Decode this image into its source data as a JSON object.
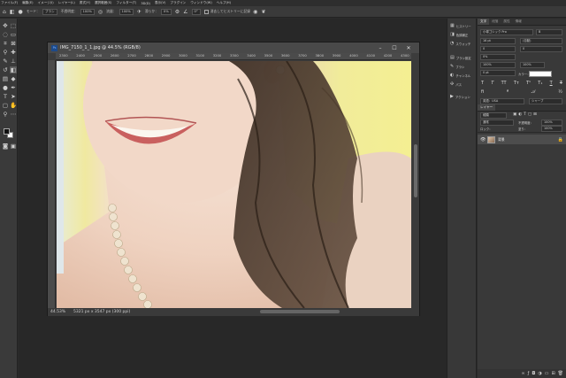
{
  "menubar": {
    "items": [
      "ファイル(F)",
      "編集(E)",
      "イメージ(I)",
      "レイヤー(L)",
      "書式(Y)",
      "選択範囲(S)",
      "フィルター(T)",
      "3D(D)",
      "表示(V)",
      "プラグイン",
      "ウィンドウ(W)",
      "ヘルプ(H)"
    ]
  },
  "options": {
    "mode_label": "モード：",
    "mode_value": "ブラシ",
    "opacity_label": "不透明度：",
    "opacity_value": "100%",
    "flow_label": "流量：",
    "flow_value": "100%",
    "smoothing_label": "滑らか：",
    "smoothing_value": "0%",
    "angle_value": "0°",
    "history_label": "消去してヒストリーに記録"
  },
  "document": {
    "badge": "Ps",
    "title": "IMG_7150_1_1.jpg @ 44.5% (RGB/8)",
    "ruler_ticks": [
      "2300",
      "2400",
      "2500",
      "2600",
      "2700",
      "2800",
      "2900",
      "3000",
      "3100",
      "3200",
      "3300",
      "3400",
      "3500",
      "3600",
      "3700",
      "3800",
      "3900",
      "4000",
      "4100",
      "4200",
      "4300"
    ],
    "zoom": "44.53%",
    "size_info": "5321 px x 3547 px (300 ppi)"
  },
  "mini_panel": {
    "items": [
      {
        "icon": "▦",
        "label": "ヒストリー"
      },
      {
        "icon": "◨",
        "label": "色調補正"
      },
      {
        "icon": "◔",
        "label": "スウォッチ"
      },
      {
        "icon": "▤",
        "label": "ブラシ設定"
      },
      {
        "icon": "✎",
        "label": "ブラシ"
      },
      {
        "icon": "◐",
        "label": "チャンネル"
      },
      {
        "icon": "✣",
        "label": "パス"
      },
      {
        "icon": "▶",
        "label": "アクション"
      }
    ]
  },
  "properties": {
    "tabs": [
      "文字",
      "段落",
      "属性",
      "情報"
    ],
    "font_family": "小塚ゴシック Pro",
    "font_style": "B",
    "font_size": "16 pt",
    "leading": "(自動)",
    "tracking": "0",
    "kerning": "0%",
    "vertical_scale": "100%",
    "horizontal_scale": "100%",
    "baseline": "0 pt",
    "color_label": "カラー：",
    "language": "英語：USA",
    "antialias": "シャープ"
  },
  "layers": {
    "tab": "レイヤー",
    "kind_label": "種類",
    "blend_mode": "通常",
    "opacity_label": "不透明度：",
    "opacity_value": "100%",
    "lock_label": "ロック：",
    "fill_label": "塗り：",
    "fill_value": "100%",
    "layer_name": "背景"
  }
}
